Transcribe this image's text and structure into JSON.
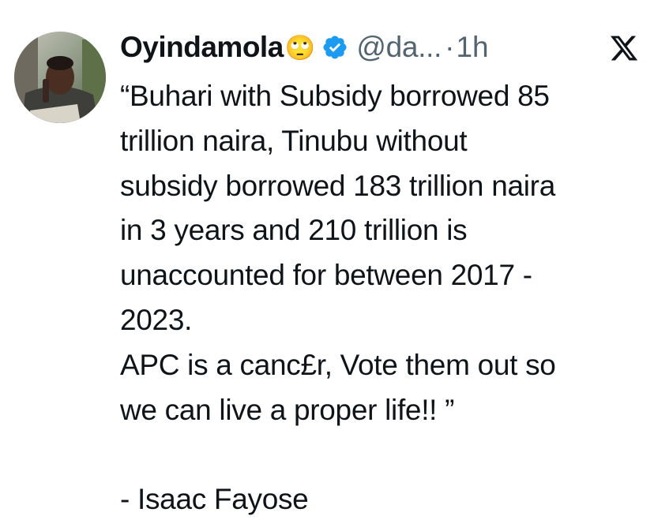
{
  "tweet": {
    "author": {
      "display_name": "Oyindamola",
      "emoji": "🙄",
      "verified_icon": "verified-badge-icon",
      "handle": "@da...",
      "separator": "·",
      "time": "1h"
    },
    "platform_icon": "x-logo-icon",
    "body_lines": [
      "“Buhari with Subsidy borrowed 85",
      "trillion naira, Tinubu without",
      "subsidy borrowed 183 trillion naira",
      "in 3 years and 210 trillion is",
      "unaccounted for between 2017 -",
      "2023.",
      "APC is a canc£r, Vote them out so",
      "we can live a proper life!! ”",
      "",
      "- Isaac Fayose"
    ]
  },
  "colors": {
    "text": "#0f1419",
    "secondary_text": "#536471",
    "verified_blue": "#1d9bf0",
    "background": "#ffffff"
  }
}
